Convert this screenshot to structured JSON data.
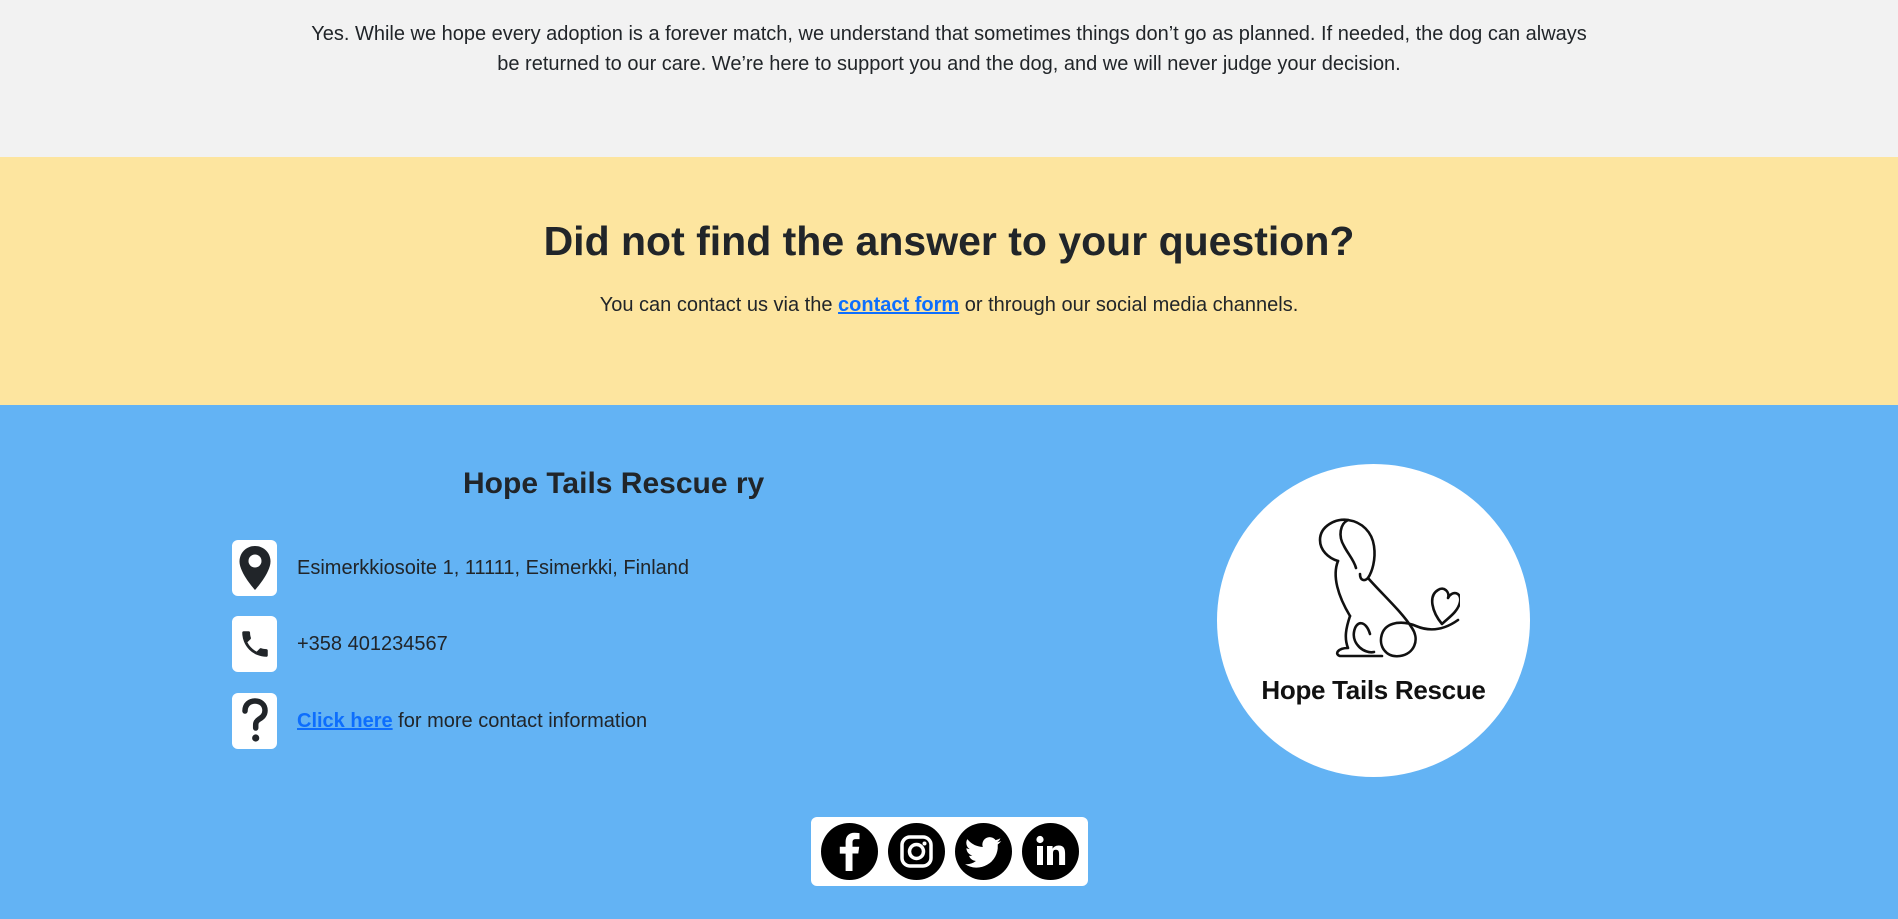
{
  "faq": {
    "answer": "Yes. While we hope every adoption is a forever match, we understand that sometimes things don’t go as planned. If needed, the dog can always be returned to our care. We’re here to support you and the dog, and we will never judge your decision."
  },
  "cta": {
    "heading": "Did not find the answer to your question?",
    "text_before": "You can contact us via the",
    "link_label": "contact form",
    "text_after": "or through our social media channels."
  },
  "footer": {
    "org_name": "Hope Tails Rescue ry",
    "address": "Esimerkkiosoite 1, 11111, Esimerkki, Finland",
    "phone": "+358 401234567",
    "more_link": "Click here",
    "more_text": "for more contact information",
    "logo_text": "Hope Tails Rescue",
    "icons": {
      "address": "location-pin-icon",
      "phone": "phone-icon",
      "more": "question-mark-icon"
    },
    "social": [
      "facebook-icon",
      "instagram-icon",
      "twitter-icon",
      "linkedin-icon"
    ]
  },
  "colors": {
    "faq_bg": "#f2f2f2",
    "cta_bg": "#fde59f",
    "footer_bg": "#63b3f4",
    "link": "#0d6efd"
  }
}
